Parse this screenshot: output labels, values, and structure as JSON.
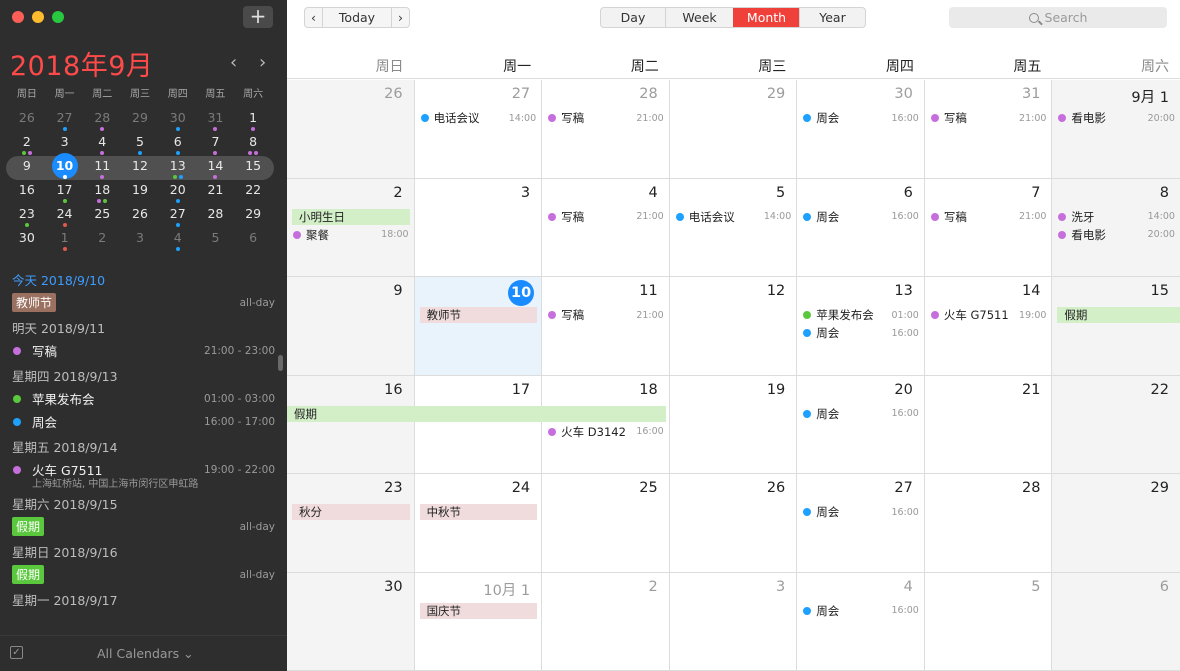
{
  "window": {
    "add_label": "+"
  },
  "mini": {
    "title": "2018年9月",
    "prev": "‹",
    "next": "›",
    "weekdays": [
      "周日",
      "周一",
      "周二",
      "周三",
      "周四",
      "周五",
      "周六"
    ],
    "weeks": [
      [
        {
          "d": "26",
          "dim": true
        },
        {
          "d": "27",
          "dim": true,
          "dots": [
            "#1ea0ff"
          ]
        },
        {
          "d": "28",
          "dim": true,
          "dots": [
            "#c66fdc"
          ]
        },
        {
          "d": "29",
          "dim": true
        },
        {
          "d": "30",
          "dim": true,
          "dots": [
            "#1ea0ff"
          ]
        },
        {
          "d": "31",
          "dim": true,
          "dots": [
            "#c66fdc"
          ]
        },
        {
          "d": "1",
          "dots": [
            "#c66fdc"
          ]
        }
      ],
      [
        {
          "d": "2",
          "dots": [
            "#5ac83c",
            "#c66fdc"
          ]
        },
        {
          "d": "3"
        },
        {
          "d": "4",
          "dots": [
            "#c66fdc"
          ]
        },
        {
          "d": "5",
          "dots": [
            "#1ea0ff"
          ]
        },
        {
          "d": "6",
          "dots": [
            "#1ea0ff"
          ]
        },
        {
          "d": "7",
          "dots": [
            "#c66fdc"
          ]
        },
        {
          "d": "8",
          "dots": [
            "#c66fdc",
            "#c66fdc"
          ]
        }
      ],
      [
        {
          "d": "9"
        },
        {
          "d": "10",
          "today": true,
          "dots": [
            "#ffffff"
          ]
        },
        {
          "d": "11",
          "dots": [
            "#c66fdc"
          ]
        },
        {
          "d": "12"
        },
        {
          "d": "13",
          "dots": [
            "#5ac83c",
            "#1ea0ff"
          ]
        },
        {
          "d": "14",
          "dots": [
            "#c66fdc"
          ]
        },
        {
          "d": "15"
        }
      ],
      [
        {
          "d": "16"
        },
        {
          "d": "17",
          "dots": [
            "#5ac83c"
          ]
        },
        {
          "d": "18",
          "dots": [
            "#c66fdc",
            "#5ac83c"
          ]
        },
        {
          "d": "19"
        },
        {
          "d": "20",
          "dots": [
            "#1ea0ff"
          ]
        },
        {
          "d": "21"
        },
        {
          "d": "22"
        }
      ],
      [
        {
          "d": "23",
          "dots": [
            "#5ac83c"
          ]
        },
        {
          "d": "24",
          "dots": [
            "#e05a4a"
          ]
        },
        {
          "d": "25"
        },
        {
          "d": "26"
        },
        {
          "d": "27",
          "dots": [
            "#1ea0ff"
          ]
        },
        {
          "d": "28"
        },
        {
          "d": "29"
        }
      ],
      [
        {
          "d": "30"
        },
        {
          "d": "1",
          "dim": true,
          "dots": [
            "#e05a4a"
          ]
        },
        {
          "d": "2",
          "dim": true
        },
        {
          "d": "3",
          "dim": true
        },
        {
          "d": "4",
          "dim": true,
          "dots": [
            "#1ea0ff"
          ]
        },
        {
          "d": "5",
          "dim": true
        },
        {
          "d": "6",
          "dim": true
        }
      ]
    ],
    "selected_week": 2
  },
  "upcoming": [
    {
      "head": "今天 2018/9/10",
      "today": true,
      "items": [
        {
          "badge": "教师节",
          "badge_color": "#9a7060",
          "time": "all-day"
        }
      ]
    },
    {
      "head": "明天 2018/9/11",
      "items": [
        {
          "name": "写稿",
          "color": "#c66fdc",
          "time": "21:00 - 23:00"
        }
      ]
    },
    {
      "head": "星期四 2018/9/13",
      "items": [
        {
          "name": "苹果发布会",
          "color": "#5ac83c",
          "time": "01:00 - 03:00"
        },
        {
          "name": "周会",
          "color": "#1ea0ff",
          "time": "16:00 - 17:00"
        }
      ]
    },
    {
      "head": "星期五 2018/9/14",
      "items": [
        {
          "name": "火车 G7511",
          "color": "#c66fdc",
          "time": "19:00 - 22:00",
          "loc": "上海虹桥站, 中国上海市闵行区申虹路"
        }
      ]
    },
    {
      "head": "星期六 2018/9/15",
      "items": [
        {
          "badge": "假期",
          "badge_color": "#5ac83c",
          "time": "all-day"
        }
      ]
    },
    {
      "head": "星期日 2018/9/16",
      "items": [
        {
          "badge": "假期",
          "badge_color": "#5ac83c",
          "time": "all-day"
        }
      ]
    },
    {
      "head": "星期一 2018/9/17",
      "items": []
    }
  ],
  "footer": {
    "calendars": "All Calendars ⌄"
  },
  "toolbar": {
    "prev": "‹",
    "today": "Today",
    "next": "›",
    "views": [
      {
        "label": "Day"
      },
      {
        "label": "Week"
      },
      {
        "label": "Month",
        "active": true
      },
      {
        "label": "Year"
      }
    ],
    "search_placeholder": "Search"
  },
  "weekdays": [
    "周日",
    "周一",
    "周二",
    "周三",
    "周四",
    "周五",
    "周六"
  ],
  "colors": {
    "purple": "#c66fdc",
    "blue": "#1ea0ff",
    "green": "#5ac83c",
    "holiday_green": "#d3efc8",
    "holiday_pink": "#f0dcdc",
    "today": "#1a8cff",
    "accent": "#f0403a"
  },
  "month": [
    {
      "d": "26",
      "dim": true
    },
    {
      "d": "27",
      "dim": true,
      "events": [
        {
          "name": "电话会议",
          "time": "14:00",
          "color": "#1ea0ff"
        }
      ]
    },
    {
      "d": "28",
      "dim": true,
      "events": [
        {
          "name": "写稿",
          "time": "21:00",
          "color": "#c66fdc"
        }
      ]
    },
    {
      "d": "29",
      "dim": true
    },
    {
      "d": "30",
      "dim": true,
      "events": [
        {
          "name": "周会",
          "time": "16:00",
          "color": "#1ea0ff"
        }
      ]
    },
    {
      "d": "31",
      "dim": true,
      "events": [
        {
          "name": "写稿",
          "time": "21:00",
          "color": "#c66fdc"
        }
      ]
    },
    {
      "d": "9月 1",
      "events": [
        {
          "name": "看电影",
          "time": "20:00",
          "color": "#c66fdc"
        }
      ]
    },
    {
      "d": "2",
      "allday": [
        {
          "name": "小明生日",
          "bg": "#d3efc8",
          "span": 1
        }
      ],
      "events": [
        {
          "name": "聚餐",
          "time": "18:00",
          "color": "#c66fdc"
        }
      ]
    },
    {
      "d": "3"
    },
    {
      "d": "4",
      "events": [
        {
          "name": "写稿",
          "time": "21:00",
          "color": "#c66fdc"
        }
      ]
    },
    {
      "d": "5",
      "events": [
        {
          "name": "电话会议",
          "time": "14:00",
          "color": "#1ea0ff"
        }
      ]
    },
    {
      "d": "6",
      "events": [
        {
          "name": "周会",
          "time": "16:00",
          "color": "#1ea0ff"
        }
      ]
    },
    {
      "d": "7",
      "events": [
        {
          "name": "写稿",
          "time": "21:00",
          "color": "#c66fdc"
        }
      ]
    },
    {
      "d": "8",
      "events": [
        {
          "name": "洗牙",
          "time": "14:00",
          "color": "#c66fdc"
        },
        {
          "name": "看电影",
          "time": "20:00",
          "color": "#c66fdc"
        }
      ]
    },
    {
      "d": "9"
    },
    {
      "d": "10",
      "today": true,
      "allday": [
        {
          "name": "教师节",
          "bg": "#f0dcdc",
          "span": 1
        }
      ]
    },
    {
      "d": "11",
      "events": [
        {
          "name": "写稿",
          "time": "21:00",
          "color": "#c66fdc"
        }
      ]
    },
    {
      "d": "12"
    },
    {
      "d": "13",
      "events": [
        {
          "name": "苹果发布会",
          "time": "01:00",
          "color": "#5ac83c"
        },
        {
          "name": "周会",
          "time": "16:00",
          "color": "#1ea0ff"
        }
      ]
    },
    {
      "d": "14",
      "events": [
        {
          "name": "火车 G7511",
          "time": "19:00",
          "color": "#c66fdc"
        }
      ]
    },
    {
      "d": "15",
      "allday": [
        {
          "name": "假期",
          "bg": "#d3efc8",
          "span": 1,
          "open_right": true
        }
      ]
    },
    {
      "d": "16",
      "allday": [
        {
          "name": "假期",
          "bg": "#d3efc8",
          "span": 3,
          "open_left": true
        }
      ]
    },
    {
      "d": "17"
    },
    {
      "d": "18",
      "events": [
        {
          "name": "火车 D3142",
          "time": "16:00",
          "color": "#c66fdc",
          "offset": 1
        }
      ]
    },
    {
      "d": "19"
    },
    {
      "d": "20",
      "events": [
        {
          "name": "周会",
          "time": "16:00",
          "color": "#1ea0ff"
        }
      ]
    },
    {
      "d": "21"
    },
    {
      "d": "22"
    },
    {
      "d": "23",
      "allday": [
        {
          "name": "秋分",
          "bg": "#f0dcdc",
          "span": 1
        }
      ]
    },
    {
      "d": "24",
      "allday": [
        {
          "name": "中秋节",
          "bg": "#f0dcdc",
          "span": 1
        }
      ]
    },
    {
      "d": "25"
    },
    {
      "d": "26"
    },
    {
      "d": "27",
      "events": [
        {
          "name": "周会",
          "time": "16:00",
          "color": "#1ea0ff"
        }
      ]
    },
    {
      "d": "28"
    },
    {
      "d": "29"
    },
    {
      "d": "30"
    },
    {
      "d": "10月 1",
      "dim": true,
      "allday": [
        {
          "name": "国庆节",
          "bg": "#f0dcdc",
          "span": 1
        }
      ]
    },
    {
      "d": "2",
      "dim": true
    },
    {
      "d": "3",
      "dim": true
    },
    {
      "d": "4",
      "dim": true,
      "events": [
        {
          "name": "周会",
          "time": "16:00",
          "color": "#1ea0ff"
        }
      ]
    },
    {
      "d": "5",
      "dim": true
    },
    {
      "d": "6",
      "dim": true
    }
  ]
}
